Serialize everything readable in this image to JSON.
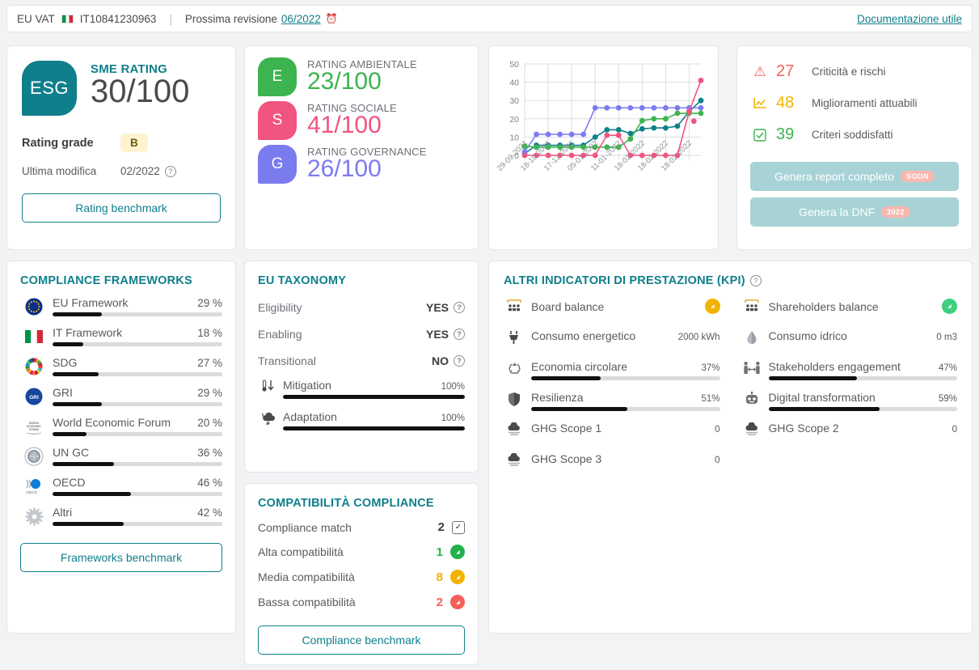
{
  "topbar": {
    "vat_label": "EU VAT",
    "flag_icon": "italy-flag-icon",
    "vat_number": "IT10841230963",
    "separator": "|",
    "revision_label": "Prossima revisione",
    "revision_date": "06/2022",
    "clock_icon": "alarm-clock-icon",
    "documentation_link": "Documentazione utile"
  },
  "esg_card": {
    "badge_text": "ESG",
    "rating_label": "SME RATING",
    "rating_value": "30/100",
    "grade_label": "Rating grade",
    "grade_value": "B",
    "modified_label": "Ultima modifica",
    "modified_value": "02/2022",
    "help_icon": "question-circle-icon",
    "benchmark_button": "Rating benchmark",
    "accent": "#0f7f8b"
  },
  "esg_breakdown": {
    "rows": [
      {
        "letter": "E",
        "label": "RATING AMBIENTALE",
        "value": "23/100",
        "color": "#3cb44f"
      },
      {
        "letter": "S",
        "label": "RATING SOCIALE",
        "value": "41/100",
        "color": "#f1547f"
      },
      {
        "letter": "G",
        "label": "RATING GOVERNANCE",
        "value": "26/100",
        "color": "#7b7bf0"
      }
    ]
  },
  "chart_data": {
    "type": "line",
    "title": "",
    "xlabel": "",
    "ylabel": "",
    "ylim": [
      0,
      50
    ],
    "yticks": [
      0,
      10,
      20,
      30,
      40,
      50
    ],
    "grid": true,
    "legend": "none",
    "x": [
      "29-09-2021",
      "29-09-2021",
      "18-10-2021",
      "18-10-2021",
      "17-12-2021",
      "17-12-2021",
      "05-01-2022",
      "05-01-2022",
      "11-01-2022",
      "11-01-2022",
      "18-02-2022",
      "18-02-2022",
      "18-02-2022",
      "18-02-2022",
      "18-02-2022",
      "18-02-2022"
    ],
    "tick_labels": [
      "29-09-2021",
      "18-10-2021",
      "17-12-2021",
      "05-01-2022",
      "11-01-2022",
      "18-02-2022",
      "18-02-2022",
      "18-02-2022"
    ],
    "series": [
      {
        "name": "ESG",
        "color": "#0f7f8b",
        "values": [
          1,
          5.5,
          5.5,
          5.5,
          5.5,
          5.5,
          10,
          14,
          14,
          12,
          14.5,
          15,
          15,
          16,
          24,
          30
        ]
      },
      {
        "name": "Governance",
        "color": "#7b7bf0",
        "values": [
          2,
          11.5,
          11.5,
          11.5,
          11.5,
          11.5,
          26,
          26,
          26,
          26,
          26,
          26,
          26,
          26,
          26,
          26
        ]
      },
      {
        "name": "Ambientale",
        "color": "#3cb44f",
        "values": [
          5,
          4.5,
          4.5,
          4.5,
          4.5,
          4.5,
          4.5,
          4.5,
          4.5,
          9,
          19,
          20,
          20,
          23,
          23,
          23
        ]
      },
      {
        "name": "Sociale",
        "color": "#f1547f",
        "values": [
          0,
          0,
          0,
          0,
          0,
          0,
          0,
          11,
          11,
          0,
          0,
          0,
          0,
          0,
          24,
          41
        ]
      }
    ],
    "extra_points": [
      {
        "series": "Sociale",
        "x_index": 14.4,
        "y": 18.7
      }
    ]
  },
  "counters": {
    "rows": [
      {
        "icon": "warning-triangle-icon",
        "value": "27",
        "label": "Criticità e rischi",
        "color": "#f4615b"
      },
      {
        "icon": "line-chart-icon",
        "value": "48",
        "label": "Miglioramenti attuabili",
        "color": "#f2b200"
      },
      {
        "icon": "check-square-icon",
        "value": "39",
        "label": "Criteri soddisfatti",
        "color": "#3cb44f"
      }
    ],
    "report_button": "Genera report completo",
    "report_pill": "SOON",
    "dnf_button": "Genera la DNF",
    "dnf_pill": "2022"
  },
  "frameworks": {
    "title": "COMPLIANCE FRAMEWORKS",
    "items": [
      {
        "icon": "eu-flag-icon",
        "name": "EU Framework",
        "pct": "29 %",
        "value": 29
      },
      {
        "icon": "italy-flag-icon",
        "name": "IT Framework",
        "pct": "18 %",
        "value": 18
      },
      {
        "icon": "sdg-wheel-icon",
        "name": "SDG",
        "pct": "27 %",
        "value": 27
      },
      {
        "icon": "gri-logo-icon",
        "name": "GRI",
        "pct": "29 %",
        "value": 29
      },
      {
        "icon": "wef-logo-icon",
        "name": "World Economic Forum",
        "pct": "20 %",
        "value": 20
      },
      {
        "icon": "un-global-compact-icon",
        "name": "UN GC",
        "pct": "36 %",
        "value": 36
      },
      {
        "icon": "oecd-logo-icon",
        "name": "OECD",
        "pct": "46 %",
        "value": 46
      },
      {
        "icon": "gear-icon",
        "name": "Altri",
        "pct": "42 %",
        "value": 42
      }
    ],
    "benchmark_button": "Frameworks benchmark"
  },
  "taxonomy": {
    "title": "EU TAXONOMY",
    "rows": [
      {
        "label": "Eligibility",
        "value": "YES"
      },
      {
        "label": "Enabling",
        "value": "YES"
      },
      {
        "label": "Transitional",
        "value": "NO"
      }
    ],
    "progress": [
      {
        "icon": "thermometer-down-icon",
        "label": "Mitigation",
        "pct": "100%",
        "value": 100
      },
      {
        "icon": "storm-cloud-icon",
        "label": "Adaptation",
        "pct": "100%",
        "value": 100
      }
    ],
    "help_icon": "question-circle-icon"
  },
  "compatibility": {
    "title": "COMPATIBILITÀ COMPLIANCE",
    "rows": [
      {
        "label": "Compliance match",
        "value": "2",
        "badge": "check-square-icon",
        "color": "#3c3c3c",
        "badge_kind": "box"
      },
      {
        "label": "Alta compatibilità",
        "value": "1",
        "badge": "compass-icon",
        "color": "#22b14c",
        "badge_kind": "circle"
      },
      {
        "label": "Media compatibilità",
        "value": "8",
        "badge": "compass-icon",
        "color": "#f2b200",
        "badge_kind": "circle"
      },
      {
        "label": "Bassa compatibilità",
        "value": "2",
        "badge": "compass-icon",
        "color": "#f4615b",
        "badge_kind": "circle"
      }
    ],
    "benchmark_button": "Compliance benchmark"
  },
  "kpi": {
    "title": "ALTRI INDICATORI DI PRESTAZIONE (KPI)",
    "help_icon": "question-circle-icon",
    "left": [
      {
        "icon": "board-icon",
        "name": "Board balance",
        "value": "",
        "badge": "compass-icon",
        "badge_color": "#f2b200",
        "bar": null
      },
      {
        "icon": "plug-icon",
        "name": "Consumo energetico",
        "value": "2000 kWh",
        "bar": null
      },
      {
        "icon": "recycle-icon",
        "name": "Economia circolare",
        "value": "37%",
        "bar": 37
      },
      {
        "icon": "shield-icon",
        "name": "Resilienza",
        "value": "51%",
        "bar": 51
      },
      {
        "icon": "cloud-ghg-icon",
        "name": "GHG Scope 1",
        "value": "0",
        "bar": null
      },
      {
        "icon": "cloud-ghg-icon",
        "name": "GHG Scope 3",
        "value": "0",
        "bar": null
      }
    ],
    "right": [
      {
        "icon": "board-icon",
        "name": "Shareholders balance",
        "value": "",
        "badge": "compass-icon",
        "badge_color": "#3ed07e",
        "bar": null
      },
      {
        "icon": "water-drop-icon",
        "name": "Consumo idrico",
        "value": "0 m3",
        "bar": null
      },
      {
        "icon": "handshake-icon",
        "name": "Stakeholders engagement",
        "value": "47%",
        "bar": 47
      },
      {
        "icon": "robot-icon",
        "name": "Digital transformation",
        "value": "59%",
        "bar": 59
      },
      {
        "icon": "cloud-ghg-icon",
        "name": "GHG Scope 2",
        "value": "0",
        "bar": null
      }
    ]
  }
}
